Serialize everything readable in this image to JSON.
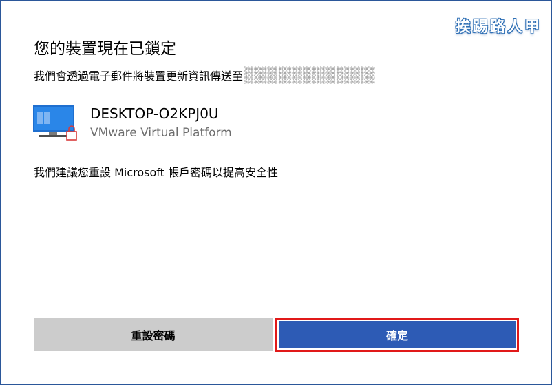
{
  "watermark": "挨踢路人甲",
  "dialog": {
    "title": "您的裝置現在已鎖定",
    "info_text": "我們會透過電子郵件將裝置更新資訊傳送至",
    "device": {
      "name": "DESKTOP-O2KPJ0U",
      "platform": "VMware Virtual Platform",
      "icon": "locked-computer-icon"
    },
    "recommendation": "我們建議您重設 Microsoft 帳戶密碼以提高安全性",
    "buttons": {
      "reset_label": "重設密碼",
      "ok_label": "確定"
    }
  },
  "colors": {
    "primary_button": "#2d5bb5",
    "secondary_button": "#cccccc",
    "highlight_border": "#e11919",
    "window_border": "#2b579a"
  }
}
